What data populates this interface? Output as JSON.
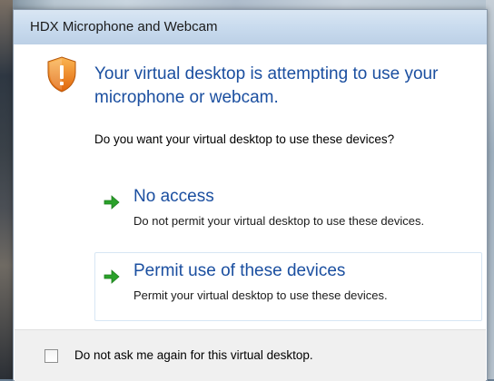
{
  "window": {
    "title": "HDX Microphone and Webcam"
  },
  "dialog": {
    "headline": "Your virtual desktop is attempting to use your microphone or webcam.",
    "question": "Do you want your virtual desktop to use these devices?",
    "options": [
      {
        "title": "No access",
        "description": "Do not permit your virtual desktop to use these devices.",
        "icon": "arrow-right-icon"
      },
      {
        "title": "Permit use of these devices",
        "description": "Permit your virtual desktop to use these devices.",
        "icon": "arrow-right-icon"
      }
    ],
    "footer_checkbox_label": "Do not ask me again for this virtual desktop.",
    "footer_checkbox_checked": false
  },
  "icons": {
    "shield": "warning-shield-icon"
  },
  "colors": {
    "accent": "#1b4fa0",
    "arrow": "#2aa12a",
    "shield": "#f08a12",
    "titlebar": "#c9dbee"
  }
}
